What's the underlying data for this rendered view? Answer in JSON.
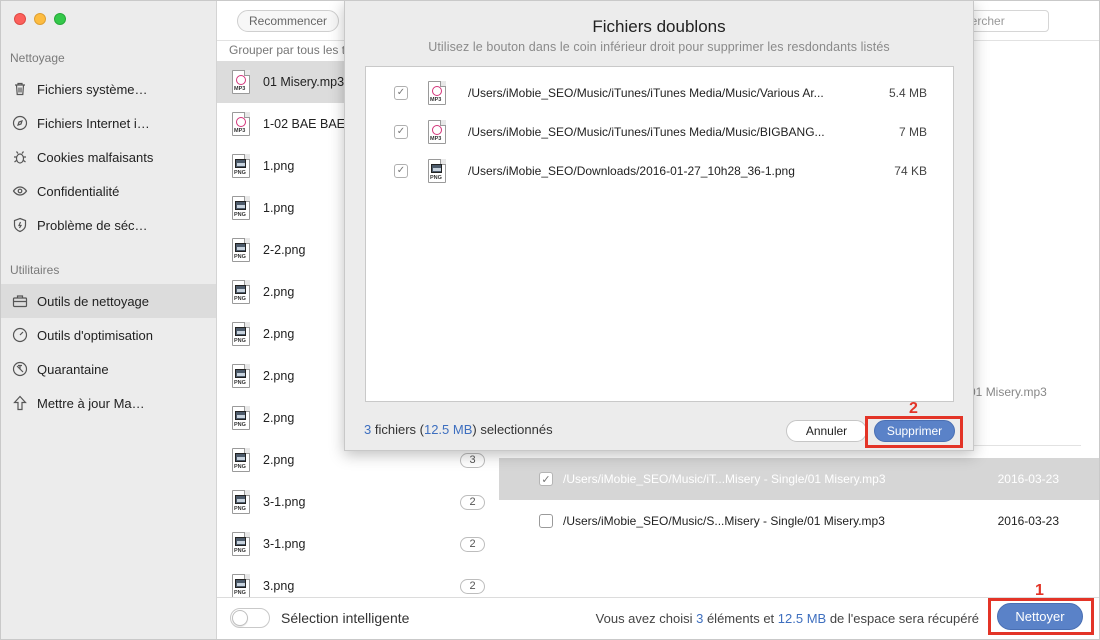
{
  "sidebar": {
    "section1_title": "Nettoyage",
    "section2_title": "Utilitaires",
    "items": [
      {
        "label": "Fichiers système…",
        "icon": "trash-icon"
      },
      {
        "label": "Fichiers Internet i…",
        "icon": "compass-icon"
      },
      {
        "label": "Cookies malfaisants",
        "icon": "bug-icon"
      },
      {
        "label": "Confidentialité",
        "icon": "eye-icon"
      },
      {
        "label": "Problème de séc…",
        "icon": "shield-icon"
      },
      {
        "label": "Outils de nettoyage",
        "icon": "toolbox-icon"
      },
      {
        "label": "Outils d'optimisation",
        "icon": "gauge-icon"
      },
      {
        "label": "Quarantaine",
        "icon": "quarantine-icon"
      },
      {
        "label": "Mettre à jour Ma…",
        "icon": "arrow-up-icon"
      }
    ]
  },
  "toolbar": {
    "restart_label": "Recommencer",
    "search_placeholder": "hercher"
  },
  "file_list": {
    "group_label": "Grouper par tous les t",
    "items": [
      {
        "name": "01 Misery.mp3",
        "type": "MP3",
        "count": ""
      },
      {
        "name": "1-02 BAE BAE",
        "type": "MP3",
        "count": ""
      },
      {
        "name": "1.png",
        "type": "PNG",
        "count": ""
      },
      {
        "name": "1.png",
        "type": "PNG",
        "count": ""
      },
      {
        "name": "2-2.png",
        "type": "PNG",
        "count": ""
      },
      {
        "name": "2.png",
        "type": "PNG",
        "count": ""
      },
      {
        "name": "2.png",
        "type": "PNG",
        "count": ""
      },
      {
        "name": "2.png",
        "type": "PNG",
        "count": ""
      },
      {
        "name": "2.png",
        "type": "PNG",
        "count": ""
      },
      {
        "name": "2.png",
        "type": "PNG",
        "count": "3"
      },
      {
        "name": "3-1.png",
        "type": "PNG",
        "count": "2"
      },
      {
        "name": "3-1.png",
        "type": "PNG",
        "count": "2"
      },
      {
        "name": "3.png",
        "type": "PNG",
        "count": "2"
      }
    ]
  },
  "detail": {
    "ghost_path": "e/01 Misery.mp3",
    "rows": [
      {
        "path": "/Users/iMobie_SEO/Music/iT...Misery - Single/01 Misery.mp3",
        "date": "2016-03-23",
        "checked": "✓"
      },
      {
        "path": "/Users/iMobie_SEO/Music/S...Misery - Single/01 Misery.mp3",
        "date": "2016-03-23",
        "checked": ""
      }
    ]
  },
  "bottombar": {
    "smart_label": "Sélection intelligente",
    "summary_prefix": "Vous avez choisi ",
    "summary_count": "3",
    "summary_mid": " éléments et ",
    "summary_size": "12.5 MB",
    "summary_suffix": " de l'espace sera récupéré",
    "clean_label": "Nettoyer",
    "marker": "1"
  },
  "modal": {
    "title": "Fichiers doublons",
    "subtitle": "Utilisez le bouton dans le coin inférieur droit pour supprimer les resdondants listés",
    "rows": [
      {
        "path": "/Users/iMobie_SEO/Music/iTunes/iTunes Media/Music/Various Ar...",
        "size": "5.4 MB",
        "type": "MP3",
        "check": "✓"
      },
      {
        "path": "/Users/iMobie_SEO/Music/iTunes/iTunes Media/Music/BIGBANG...",
        "size": "7 MB",
        "type": "MP3",
        "check": "✓"
      },
      {
        "path": "/Users/iMobie_SEO/Downloads/2016-01-27_10h28_36-1.png",
        "size": "74 KB",
        "type": "PNG",
        "check": "✓"
      }
    ],
    "count_num": "3",
    "count_mid": " fichiers (",
    "count_size": "12.5 MB",
    "count_suffix": ") selectionnés",
    "cancel_label": "Annuler",
    "delete_label": "Supprimer",
    "marker": "2"
  },
  "colors": {
    "accent": "#5a82c8",
    "highlight": "#e33427"
  }
}
